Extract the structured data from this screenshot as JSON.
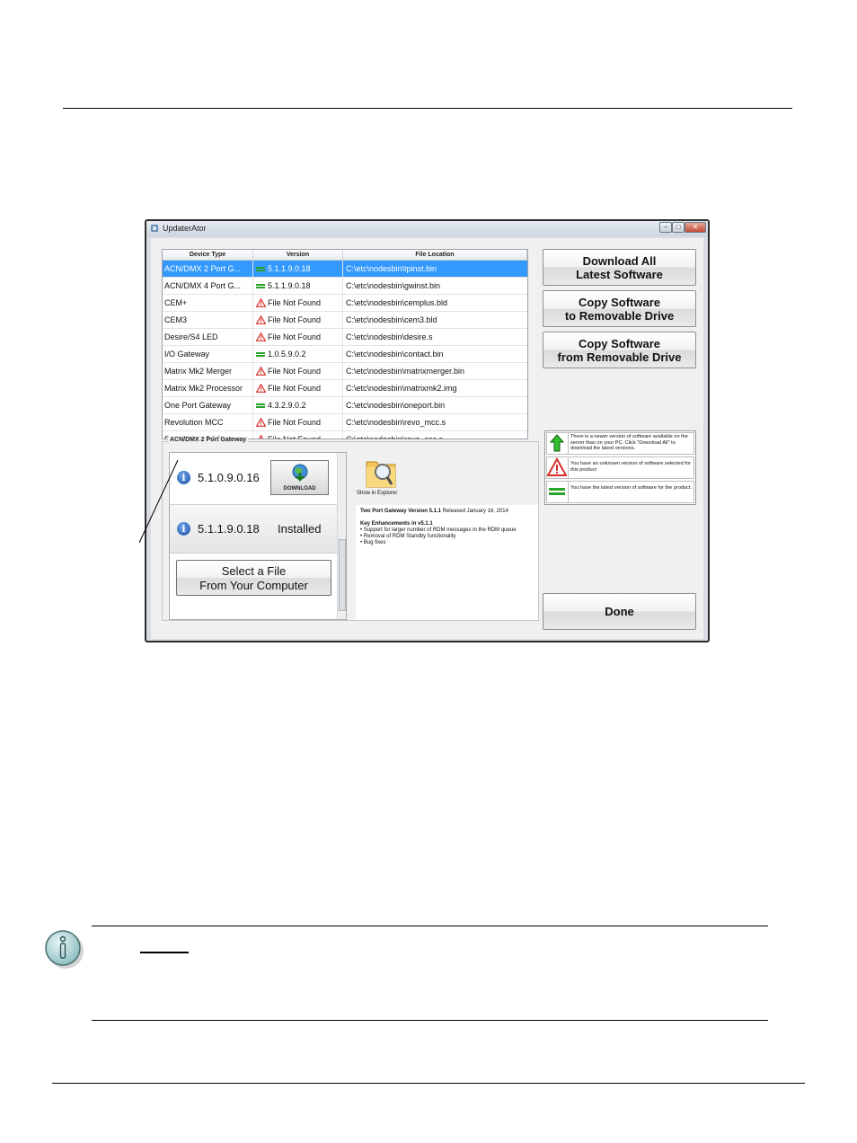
{
  "window": {
    "title": "UpdaterAtor",
    "min_glyph": "–",
    "max_glyph": "□",
    "close_glyph": "✕"
  },
  "grid": {
    "headers": [
      "Device Type",
      "Version",
      "File Location"
    ],
    "rows": [
      {
        "device": "ACN/DMX 2 Port G...",
        "version": "5.1.1.9.0.18",
        "status": "current",
        "location": "C:\\etc\\nodesbin\\tpinst.bin",
        "selected": true
      },
      {
        "device": "ACN/DMX 4 Port G...",
        "version": "5.1.1.9.0.18",
        "status": "current",
        "location": "C:\\etc\\nodesbin\\gwinst.bin"
      },
      {
        "device": "CEM+",
        "version": "File Not Found",
        "status": "unknown",
        "location": "C:\\etc\\nodesbin\\cemplus.bld"
      },
      {
        "device": "CEM3",
        "version": "File Not Found",
        "status": "unknown",
        "location": "C:\\etc\\nodesbin\\cem3.bld"
      },
      {
        "device": "Desire/S4 LED",
        "version": "File Not Found",
        "status": "unknown",
        "location": "C:\\etc\\nodesbin\\desire.s"
      },
      {
        "device": "I/O Gateway",
        "version": "1.0.5.9.0.2",
        "status": "current",
        "location": "C:\\etc\\nodesbin\\contact.bin"
      },
      {
        "device": "Matrix Mk2 Merger",
        "version": "File Not Found",
        "status": "unknown",
        "location": "C:\\etc\\nodesbin\\matrixmerger.bin"
      },
      {
        "device": "Matrix Mk2 Processor",
        "version": "File Not Found",
        "status": "unknown",
        "location": "C:\\etc\\nodesbin\\matrixmk2.img"
      },
      {
        "device": "One Port Gateway",
        "version": "4.3.2.9.0.2",
        "status": "current",
        "location": "C:\\etc\\nodesbin\\oneport.bin"
      },
      {
        "device": "Revolution MCC",
        "version": "File Not Found",
        "status": "unknown",
        "location": "C:\\etc\\nodesbin\\revo_mcc.s"
      },
      {
        "device": "Revolution SCC",
        "version": "File Not Found",
        "status": "unknown",
        "location": "C:\\etc\\nodesbin\\revo_scc.s"
      }
    ]
  },
  "buttons": {
    "download_all_l1": "Download All",
    "download_all_l2": "Latest Software",
    "copy_to_l1": "Copy Software",
    "copy_to_l2": "to Removable Drive",
    "copy_from_l1": "Copy Software",
    "copy_from_l2": "from Removable Drive",
    "done": "Done"
  },
  "detail": {
    "group_label": "ACN/DMX 2 Port Gateway",
    "versions": [
      {
        "number": "5.1.0.9.0.16",
        "action": "DOWNLOAD"
      },
      {
        "number": "5.1.1.9.0.18",
        "status": "Installed"
      }
    ],
    "select_file_l1": "Select a File",
    "select_file_l2": "From Your Computer",
    "show_in_explorer": "Show in Explorer",
    "notes_title": "Two Port Gateway Version 5.1.1",
    "notes_date": " Released January 16, 2014",
    "notes_heading": "Key Enhancements in v5.1.1",
    "notes_items": [
      "Support for larger number of RDM messages in the RDM queue",
      "Removal of RDM Standby functionality",
      "Bug fixes"
    ]
  },
  "legend": [
    {
      "icon": "green-up-arrow-icon",
      "text": "There is a newer version of software available on the server than on your PC. Click \"Download All\" to download the latest versions."
    },
    {
      "icon": "red-warning-icon",
      "text": "You have an unknown version of software selected for this product"
    },
    {
      "icon": "green-equals-icon",
      "text": "You have the latest version of software for the product."
    }
  ],
  "colors": {
    "selection": "#3399ff",
    "current": "#2aa32a",
    "warning": "#d9302a"
  }
}
